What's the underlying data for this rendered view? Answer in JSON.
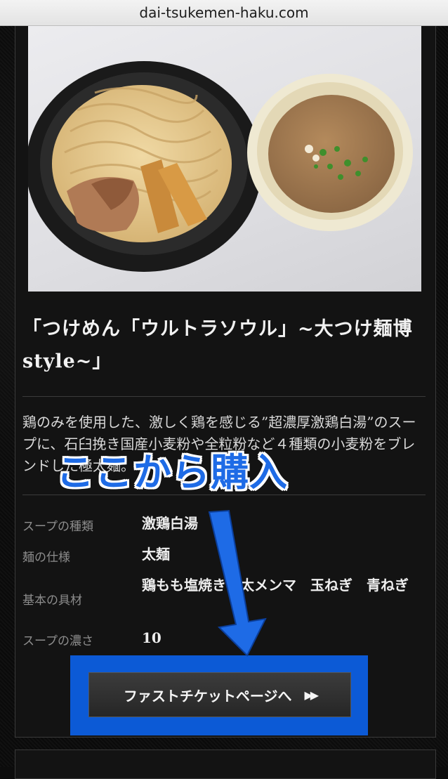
{
  "browser": {
    "url": "dai-tsukemen-haku.com"
  },
  "product": {
    "title": "「つけめん「ウルトラソウル」~大つけ麺博style~」",
    "description": "鶏のみを使用した、激しく鶏を感じる”超濃厚激鶏白湯”のスープに、石臼挽き国産小麦粉や全粒粉など４種類の小麦粉をブレンドした極太麺。",
    "specs": [
      {
        "label": "スープの種類",
        "value": "激鶏白湯"
      },
      {
        "label": "麺の仕様",
        "value": "太麺"
      },
      {
        "label": "基本の具材",
        "value": "鶏もも塩焼き　太メンマ　玉ねぎ　青ねぎ"
      },
      {
        "label": "スープの濃さ",
        "value": "10"
      }
    ],
    "button_label": "ファストチケットページへ",
    "button_icon": "double-chevron-right-icon"
  },
  "annotation": {
    "text": "ここから購入",
    "color": "#1e6be6"
  }
}
